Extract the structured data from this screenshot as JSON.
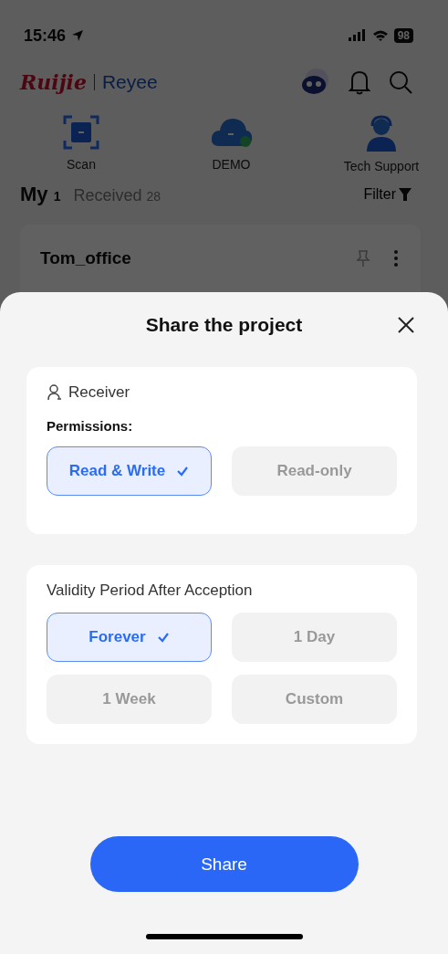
{
  "status_bar": {
    "time": "15:46",
    "battery": "98"
  },
  "header": {
    "logo_brand": "Ruijie",
    "logo_product": "Reyee"
  },
  "quick_actions": [
    {
      "label": "Scan",
      "kind": "scan"
    },
    {
      "label": "DEMO",
      "kind": "cloud"
    },
    {
      "label": "Tech Support",
      "kind": "support"
    }
  ],
  "tabs": [
    {
      "label": "My",
      "count": "1",
      "selected": true
    },
    {
      "label": "Received",
      "count": "28",
      "selected": false
    }
  ],
  "filter": "Filter",
  "project_card": {
    "name": "Tom_office"
  },
  "sheet": {
    "title": "Share the project",
    "receiver_label": "Receiver",
    "permissions_label": "Permissions:",
    "permissions": [
      {
        "label": "Read & Write",
        "selected": true
      },
      {
        "label": "Read-only",
        "selected": false
      }
    ],
    "validity_label": "Validity Period After Acception",
    "validity_options": [
      {
        "label": "Forever",
        "selected": true
      },
      {
        "label": "1 Day",
        "selected": false
      },
      {
        "label": "1 Week",
        "selected": false
      },
      {
        "label": "Custom",
        "selected": false
      }
    ],
    "share_button": "Share"
  }
}
